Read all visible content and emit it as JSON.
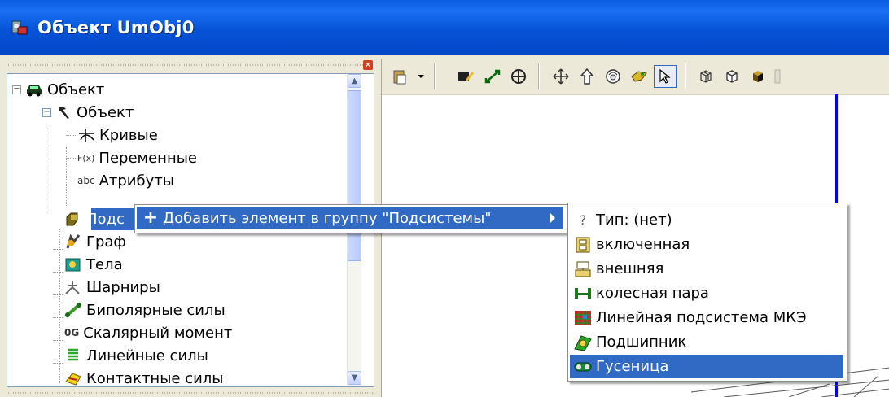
{
  "window": {
    "title": "Объект UmObj0"
  },
  "tree": {
    "items": [
      {
        "label": "Объект",
        "icon": "car-icon",
        "level": 0
      },
      {
        "label": "Объект",
        "icon": "hammer-icon",
        "level": 1
      },
      {
        "label": "Кривые",
        "icon": "curves-icon",
        "level": 2
      },
      {
        "label": "Переменные",
        "icon": "function-icon",
        "level": 2,
        "prefix": "F(x)"
      },
      {
        "label": "Атрибуты",
        "icon": "abc-icon",
        "level": 2,
        "prefix": "abc"
      },
      {
        "label": "Подс",
        "icon": "subsystem-icon",
        "level": 1,
        "selected": true
      },
      {
        "label": "Граф",
        "icon": "graphics-icon",
        "level": 1
      },
      {
        "label": "Тела",
        "icon": "body-icon",
        "level": 1
      },
      {
        "label": "Шарниры",
        "icon": "joint-icon",
        "level": 1
      },
      {
        "label": "Биполярные силы",
        "icon": "bipolar-force-icon",
        "level": 1
      },
      {
        "label": "Скалярный момент",
        "icon": "scalar-torque-icon",
        "level": 1,
        "prefix": "0G"
      },
      {
        "label": "Линейные силы",
        "icon": "linear-force-icon",
        "level": 1
      },
      {
        "label": "Контактные силы",
        "icon": "contact-force-icon",
        "level": 1
      }
    ]
  },
  "context_menu": {
    "item": "Добавить элемент в группу \"Подсистемы\""
  },
  "submenu": {
    "items": [
      {
        "label": "Тип: (нет)",
        "icon": "question-icon",
        "prefix": "?"
      },
      {
        "label": "включенная",
        "icon": "included-icon"
      },
      {
        "label": "внешняя",
        "icon": "external-icon"
      },
      {
        "label": "колесная пара",
        "icon": "wheelset-icon"
      },
      {
        "label": "Линейная подсистема МКЭ",
        "icon": "fem-icon"
      },
      {
        "label": "Подшипник",
        "icon": "bearing-icon"
      },
      {
        "label": "Гусеница",
        "icon": "track-icon",
        "selected": true
      }
    ]
  },
  "colors": {
    "titlebar": "#0553d6",
    "selection": "#316ac5",
    "axis": "#0000ff"
  }
}
